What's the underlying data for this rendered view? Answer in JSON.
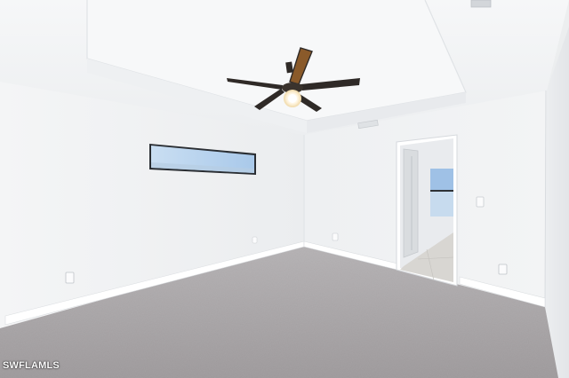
{
  "photo": {
    "watermark": "SWFLAMLS",
    "ceiling_fan": {
      "blade_count": 5,
      "light": "on"
    },
    "colors": {
      "wall": "#f2f3f4",
      "ceiling": "#f5f6f7",
      "carpet": "#a8a4a6",
      "fan_blade": "#2f2a27",
      "fan_blade_lit": "#8a5a2a"
    }
  }
}
